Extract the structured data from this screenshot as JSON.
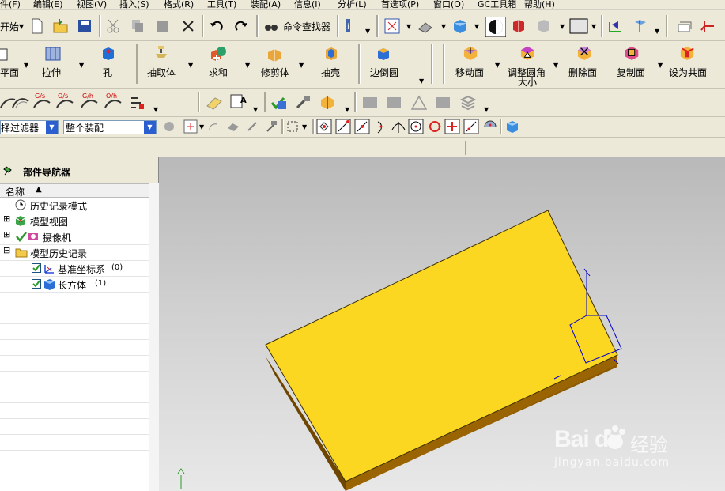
{
  "menu": [
    "件(F)",
    "编辑(E)",
    "视图(V)",
    "插入(S)",
    "格式(R)",
    "工具(T)",
    "装配(A)",
    "信息(I)",
    "分析(L)",
    "首选项(P)",
    "窗口(O)",
    "GC工具箱",
    "帮助(H)"
  ],
  "toolbar1": {
    "start_label": "开始",
    "command_finder": "命令查找器"
  },
  "toolbar2": {
    "buttons": [
      "平面",
      "拉伸",
      "孔",
      "抽取体",
      "求和",
      "修剪体",
      "抽壳",
      "边倒圆",
      "移动面",
      "调整圆角",
      "删除面",
      "复制面",
      "设为共面"
    ],
    "adjust_line2": "大小"
  },
  "toolbar4": {
    "filter": "择过滤器",
    "scope": "整个装配"
  },
  "navigator": {
    "title": "部件导航器",
    "column_name": "名称",
    "items": [
      {
        "label": "历史记录模式"
      },
      {
        "label": "模型视图"
      },
      {
        "label": "摄像机"
      },
      {
        "label": "模型历史记录"
      },
      {
        "label": "基准坐标系",
        "count": "(0)"
      },
      {
        "label": "长方体",
        "count": "(1)"
      }
    ]
  },
  "watermark": {
    "brand": "Bai",
    "brand2": "du",
    "cn": "经验",
    "url": "jingyan.baidu.com"
  },
  "colors": {
    "block_top": "#fcd722",
    "block_side": "#8b5a00",
    "highlight": "#0000cc"
  }
}
